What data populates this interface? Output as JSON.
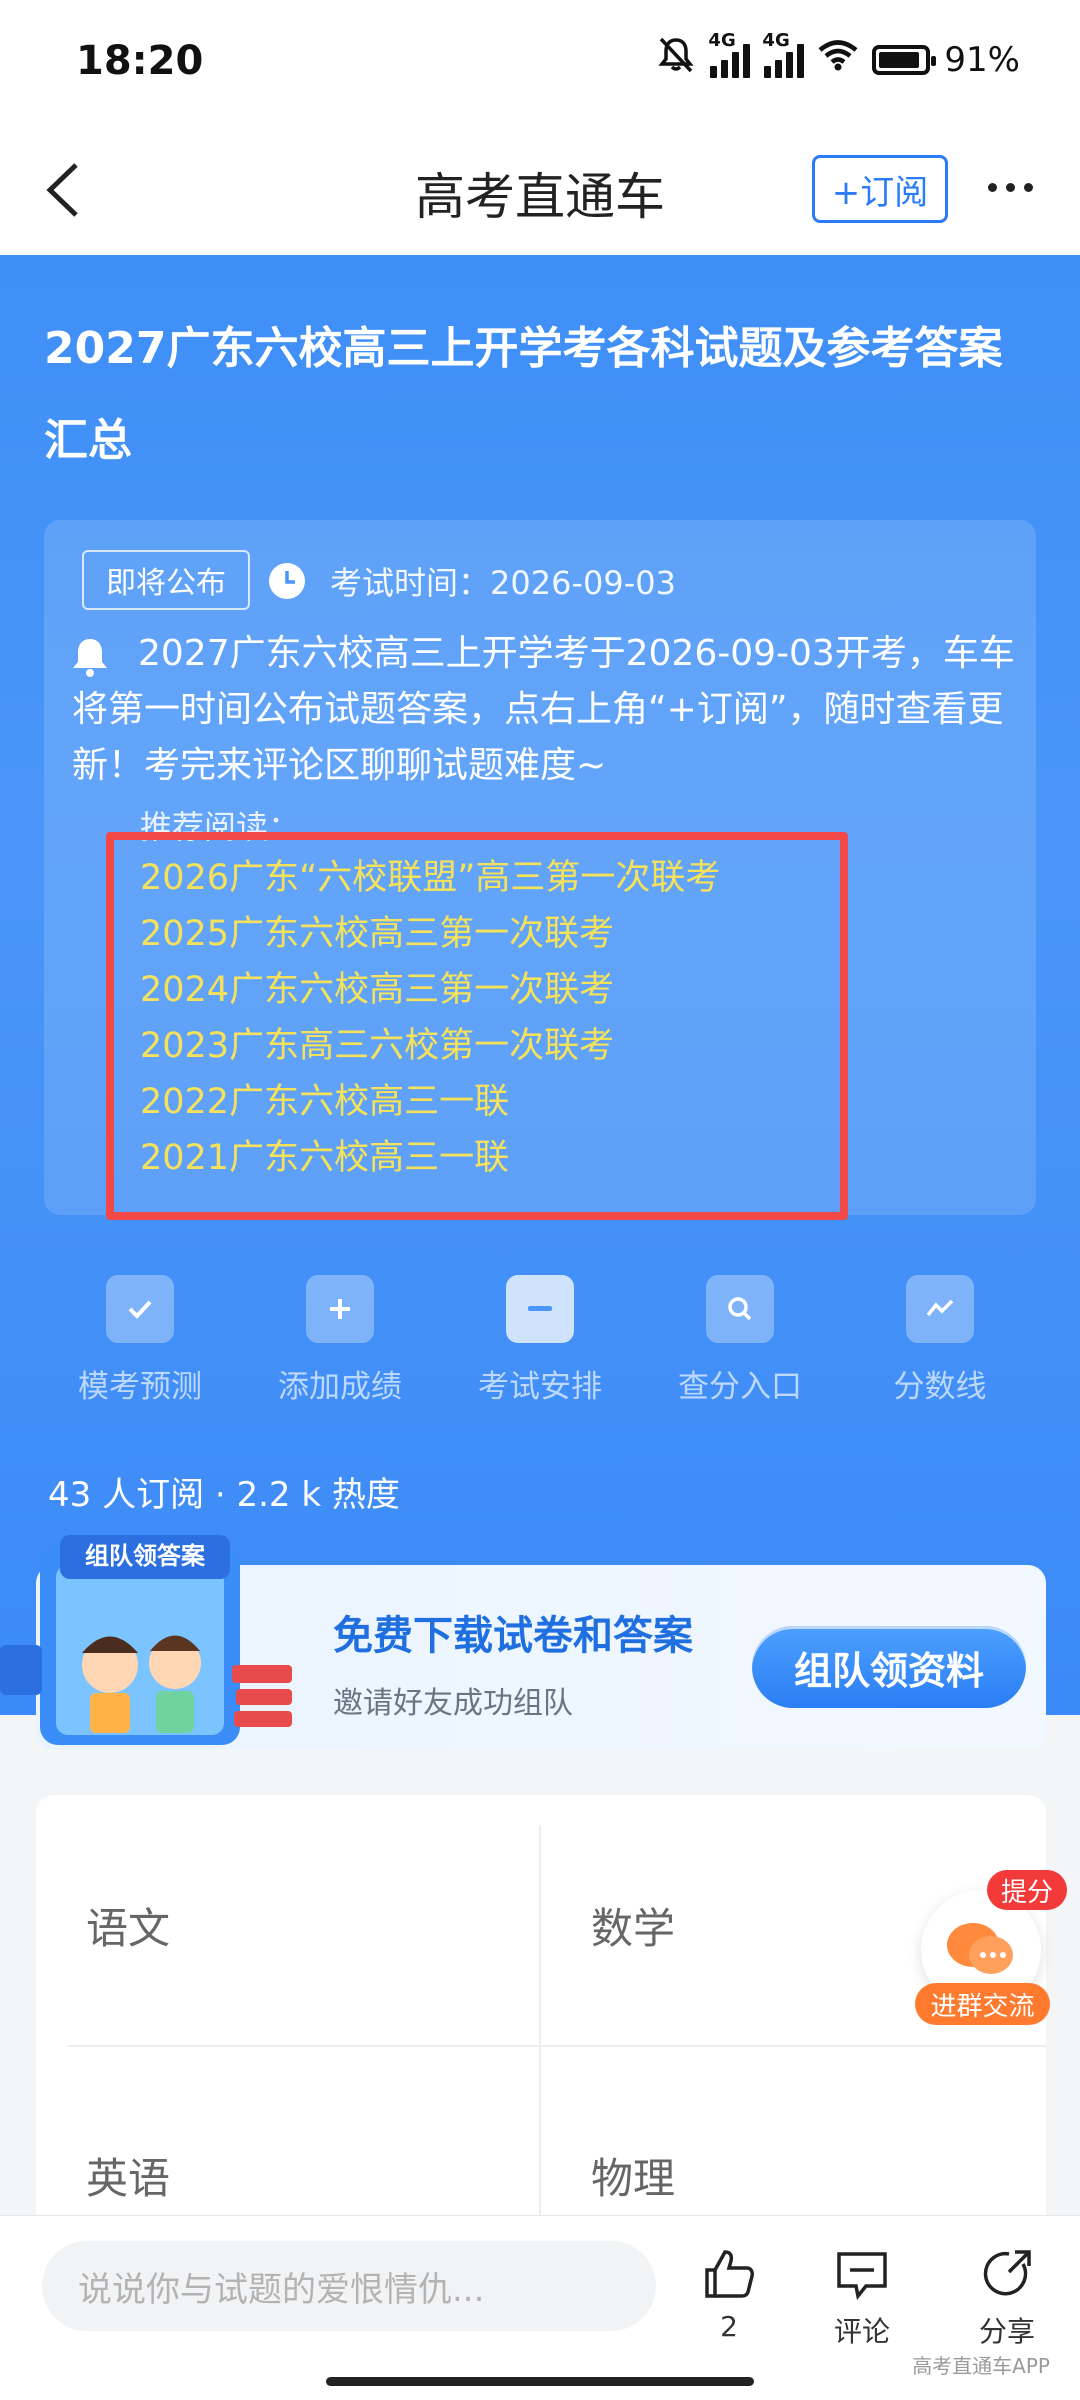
{
  "status_bar": {
    "time": "18:20",
    "network_1": "4G",
    "network_2": "4G",
    "battery": "91%",
    "battery_fraction": 0.91
  },
  "nav": {
    "title": "高考直通车",
    "subscribe_label": "+订阅"
  },
  "hero": {
    "title": "2027广东六校高三上开学考各科试题及参考答案汇总",
    "status_tag": "即将公布",
    "exam_date": "考试时间：2026-09-03",
    "notice": "2027广东六校高三上开学考于2026-09-03开考，车车将第一时间公布试题答案，点右上角“+订阅”，随时查看更新！考完来评论区聊聊试题难度~",
    "recommend_label": "推荐阅读：",
    "recommended": [
      "2026广东“六校联盟”高三第一次联考",
      "2025广东六校高三第一次联考",
      "2024广东六校高三第一次联考",
      "2023广东高三六校第一次联考",
      "2022广东六校高三一联",
      "2021广东六校高三一联"
    ]
  },
  "shortcuts": [
    {
      "label": "模考预测",
      "icon": "check-clipboard-icon"
    },
    {
      "label": "添加成绩",
      "icon": "plus-icon"
    },
    {
      "label": "考试安排",
      "icon": "calendar-icon"
    },
    {
      "label": "查分入口",
      "icon": "search-icon"
    },
    {
      "label": "分数线",
      "icon": "trend-line-icon"
    }
  ],
  "stats": {
    "subscribers": "43 人订阅 · 2.2 k 热度"
  },
  "banner": {
    "art_label": "组队领答案",
    "title": "免费下载试卷和答案",
    "subtitle": "邀请好友成功组队",
    "button_label": "组队领资料"
  },
  "subjects": [
    "语文",
    "数学",
    "英语",
    "物理"
  ],
  "float_chat": {
    "tag": "提分",
    "label": "进群交流"
  },
  "bottom_bar": {
    "comment_placeholder": "说说你与试题的爱恨情仇...",
    "like_count": "2",
    "comment_label": "评论",
    "share_label": "分享",
    "watermark": "高考直通车APP"
  },
  "colors": {
    "accent_blue": "#2b7cf6",
    "hero_blue": "#4a96f8",
    "link_yellow": "#f6e25a",
    "highlight_red": "#f24848",
    "chat_orange": "#ff7a2e"
  }
}
